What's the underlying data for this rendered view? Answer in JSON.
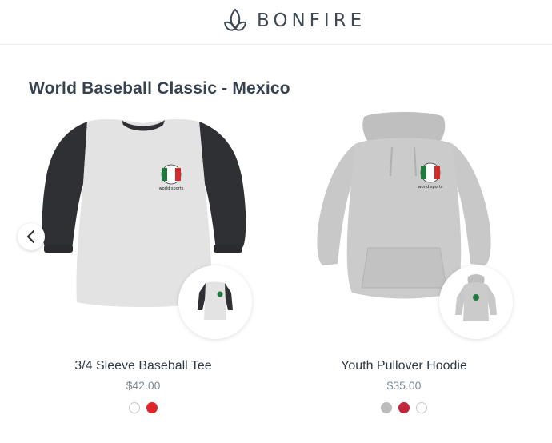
{
  "header": {
    "brand": "BONFIRE",
    "logo_icon": "bonfire-leaf-icon"
  },
  "collection": {
    "title": "World Baseball Classic - Mexico"
  },
  "carousel": {
    "prev_icon": "chevron-left-icon"
  },
  "products": [
    {
      "name": "3/4 Sleeve Baseball Tee",
      "price": "$42.00",
      "swatches": [
        {
          "color": "#ffffff",
          "border": "#c9c9c9",
          "selected": false
        },
        {
          "color": "#e0242b",
          "border": "#e0242b",
          "selected": true
        }
      ]
    },
    {
      "name": "Youth Pullover Hoodie",
      "price": "$35.00",
      "swatches": [
        {
          "color": "#bcbcbc",
          "border": "#bcbcbc",
          "selected": false
        },
        {
          "color": "#c2263a",
          "border": "#c2263a",
          "selected": true
        },
        {
          "color": "#ffffff",
          "border": "#c9c9c9",
          "selected": false
        }
      ]
    }
  ],
  "colors": {
    "title": "#36424e",
    "price": "#7f8c96",
    "tee_sleeve": "#2f3033",
    "tee_body": "#e3e3e3",
    "hoodie": "#c8c8c8"
  }
}
